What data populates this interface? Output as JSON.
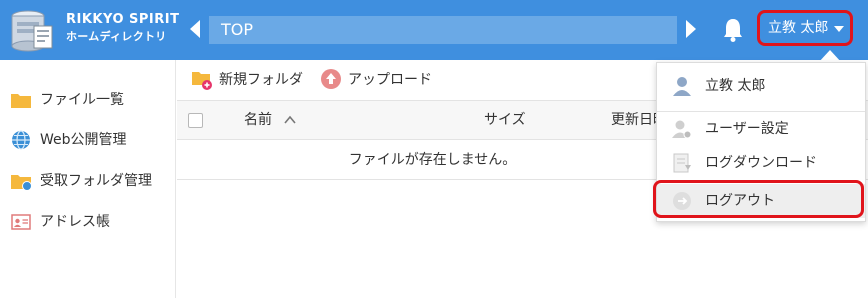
{
  "header": {
    "brand_line1": "RIKKYO SPIRIT",
    "brand_line2": "ホームディレクトリ",
    "path": "TOP",
    "user_name": "立教 太郎",
    "colors": {
      "bar": "#3f8fdf",
      "path_field": "#6aa9e6",
      "highlight": "#e0141b"
    }
  },
  "sidebar": {
    "items": [
      {
        "label": "ファイル一覧",
        "icon": "folder-icon"
      },
      {
        "label": "Web公開管理",
        "icon": "globe-icon"
      },
      {
        "label": "受取フォルダ管理",
        "icon": "shared-folder-icon"
      },
      {
        "label": "アドレス帳",
        "icon": "address-card-icon"
      }
    ]
  },
  "toolbar": {
    "new_folder_label": "新規フォルダ",
    "upload_label": "アップロード"
  },
  "table": {
    "columns": [
      "名前",
      "サイズ",
      "更新日時"
    ],
    "empty_message": "ファイルが存在しません。"
  },
  "user_dropdown": {
    "user_label": "立教 太郎",
    "items": [
      {
        "label": "ユーザー設定",
        "icon": "user-settings-icon"
      },
      {
        "label": "ログダウンロード",
        "icon": "log-download-icon"
      },
      {
        "label": "ログアウト",
        "icon": "logout-icon"
      }
    ]
  }
}
